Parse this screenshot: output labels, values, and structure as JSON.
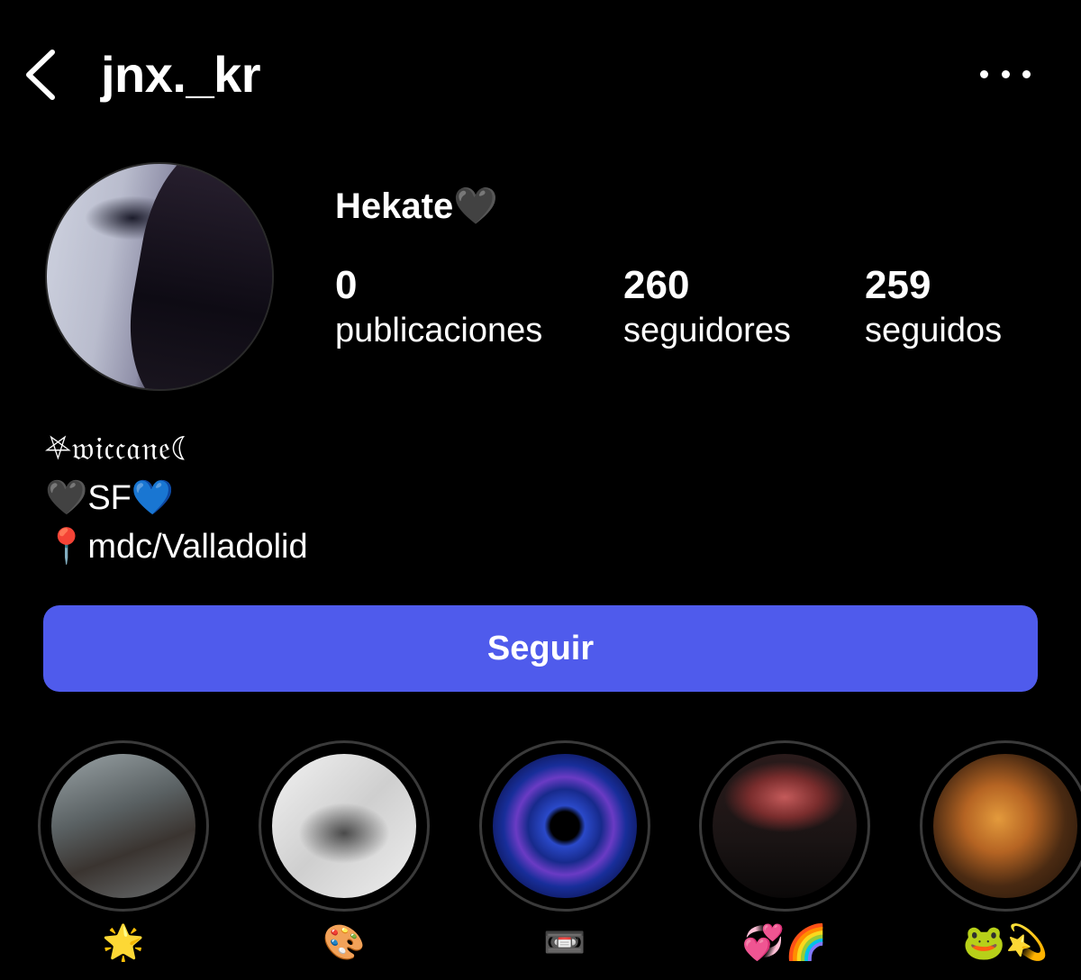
{
  "header": {
    "username": "jnx._kr",
    "back_icon": "chevron-left-icon",
    "more_icon": "more-horizontal-icon"
  },
  "profile": {
    "display_name": "Hekate🖤",
    "stats": [
      {
        "value": "0",
        "label": "publicaciones"
      },
      {
        "value": "260",
        "label": "seguidores"
      },
      {
        "value": "259",
        "label": "seguidos"
      }
    ],
    "bio": [
      "⛧𝔴𝔦𝔠𝔠𝔞𝔫𝔢☾",
      "🖤SF💙",
      "📍mdc/Valladolid"
    ]
  },
  "actions": {
    "follow_label": "Seguir",
    "follow_color": "#4f5bec"
  },
  "highlights": [
    {
      "label": "🌟"
    },
    {
      "label": "🎨"
    },
    {
      "label": "📼"
    },
    {
      "label": "💞🌈"
    },
    {
      "label": "🐸💫"
    }
  ]
}
